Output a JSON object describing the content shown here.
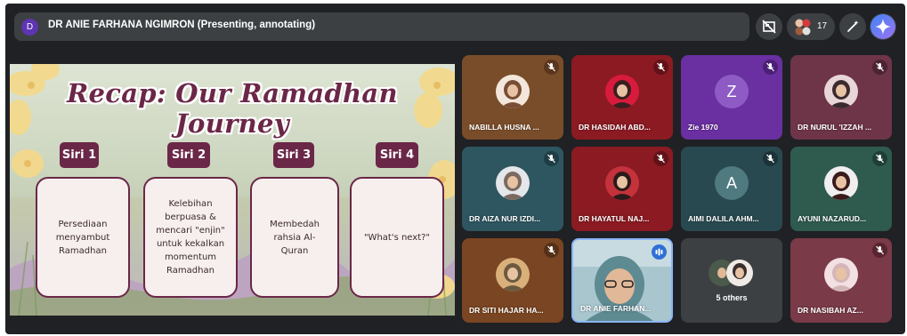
{
  "header": {
    "presenter_initial": "D",
    "presenter_label": "DR ANIE FARHANA NGIMRON (Presenting, annotating)",
    "people_count": "17"
  },
  "slide": {
    "title": "Recap: Our Ramadhan Journey",
    "sections": [
      {
        "tag": "Siri 1",
        "text": "Persediaan\nmenyambut\nRamadhan"
      },
      {
        "tag": "Siri 2",
        "text": "Kelebihan\nberpuasa &\nmencari \"enjin\"\nuntuk kekalkan\nmomentum\nRamadhan"
      },
      {
        "tag": "Siri 3",
        "text": "Membedah\nrahsia Al-\nQuran"
      },
      {
        "tag": "Siri 4",
        "text": "\"What's next?\""
      }
    ]
  },
  "participants": [
    {
      "name": "NABILLA HUSNA ...",
      "bg": "#7a4d2a",
      "mic_bg": "#5a361d",
      "avatar_bg": "#f3e7dc",
      "muted": true
    },
    {
      "name": "DR HASIDAH ABD...",
      "bg": "#8b1a22",
      "mic_bg": "#611218",
      "avatar_bg": "#d81b3c",
      "muted": true
    },
    {
      "name": "Zie 1970",
      "bg": "#6a2fa0",
      "mic_bg": "#4b1f75",
      "letter": "Z",
      "letter_bg": "#8e5bc4",
      "muted": true
    },
    {
      "name": "DR NURUL 'IZZAH ...",
      "bg": "#6e3448",
      "mic_bg": "#4d2333",
      "avatar_bg": "#e8d6d8",
      "muted": true
    },
    {
      "name": "DR AIZA NUR IZDI...",
      "bg": "#2e5660",
      "mic_bg": "#1f3d44",
      "avatar_bg": "#e4e6ea",
      "muted": true
    },
    {
      "name": "DR HAYATUL NAJ...",
      "bg": "#8b1a22",
      "mic_bg": "#611218",
      "avatar_bg": "#c4323b",
      "muted": true
    },
    {
      "name": "AIMI DALILA AHM...",
      "bg": "#28494f",
      "mic_bg": "#1b3338",
      "letter": "A",
      "letter_bg": "#4f7a80",
      "muted": true
    },
    {
      "name": "AYUNI NAZARUD...",
      "bg": "#2f5a4e",
      "mic_bg": "#1f3f36",
      "avatar_bg": "#f0eeee",
      "muted": true
    },
    {
      "name": "DR SITI HAJAR HA...",
      "bg": "#7a4522",
      "mic_bg": "#553017",
      "avatar_bg": "#d9b07a",
      "muted": true
    },
    {
      "name": "DR ANIE FARHAN...",
      "bg": "#9fbfc9",
      "mic_bg": "#2f6fd6",
      "avatar_bg": "",
      "speaking": true
    },
    {
      "others_label": "5 others",
      "bg": "#3c4043"
    },
    {
      "name": "DR NASIBAH AZ...",
      "bg": "#7a3a48",
      "mic_bg": "#57242f",
      "avatar_bg": "#f2e0e3",
      "muted": true
    }
  ]
}
